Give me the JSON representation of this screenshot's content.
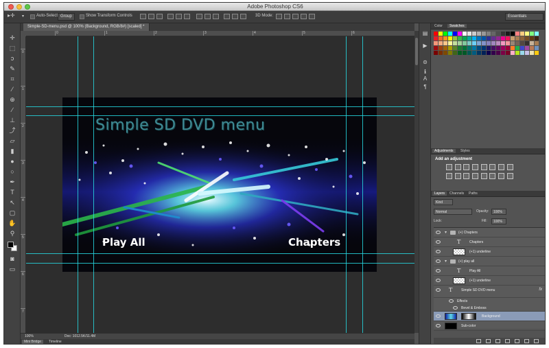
{
  "window": {
    "title": "Adobe Photoshop CS6"
  },
  "options_bar": {
    "auto_select_label": "Auto-Select:",
    "auto_select_value": "Group",
    "show_transform_label": "Show Transform Controls",
    "mode_label": "3D Mode:",
    "workspace": "Essentials"
  },
  "document": {
    "tab_title": "Simple-SD-menu.psd @ 100% (Background, RGB/8#) [scaled] *",
    "zoom": "100%",
    "doc_info": "Doc: 1012.5K/11.4M"
  },
  "rulers": {
    "h": [
      "0",
      "1",
      "2",
      "3",
      "4",
      "5",
      "6"
    ],
    "v": [
      "0",
      "1",
      "2",
      "3",
      "4",
      "5",
      "6",
      "7"
    ]
  },
  "artwork": {
    "title": "Simple SD DVD menu",
    "button_play": "Play All",
    "button_chapters": "Chapters"
  },
  "bottom_tabs": [
    "Mini Bridge",
    "Timeline"
  ],
  "panels": {
    "color_tabs": [
      "Color",
      "Swatches"
    ],
    "adjustments_tabs": [
      "Adjustments",
      "Styles"
    ],
    "adjustments_title": "Add an adjustment",
    "layers_tabs": [
      "Layers",
      "Channels",
      "Paths"
    ],
    "kind_label": "Kind",
    "blend_mode": "Normal",
    "opacity_label": "Opacity:",
    "opacity_value": "100%",
    "lock_label": "Lock:",
    "fill_label": "Fill:",
    "fill_value": "100%"
  },
  "layers": [
    {
      "name": "(+) Chapters",
      "kind": "group"
    },
    {
      "name": "Chapters",
      "kind": "text"
    },
    {
      "name": "(+1) underline",
      "kind": "pixel"
    },
    {
      "name": "(+) play all",
      "kind": "group"
    },
    {
      "name": "Play All",
      "kind": "text"
    },
    {
      "name": "(+1) underline",
      "kind": "pixel"
    },
    {
      "name": "Simple SD DVD menu",
      "kind": "text",
      "fx": "fx"
    },
    {
      "name": "Effects",
      "kind": "effect"
    },
    {
      "name": "Bevel & Emboss",
      "kind": "effect"
    },
    {
      "name": "Background",
      "kind": "image",
      "selected": true
    },
    {
      "name": "Sub-color",
      "kind": "solid"
    }
  ],
  "colors": {
    "guide": "#27d7e0",
    "title_teal": "#3f8a94",
    "selected_layer": "#8a9bb7"
  }
}
